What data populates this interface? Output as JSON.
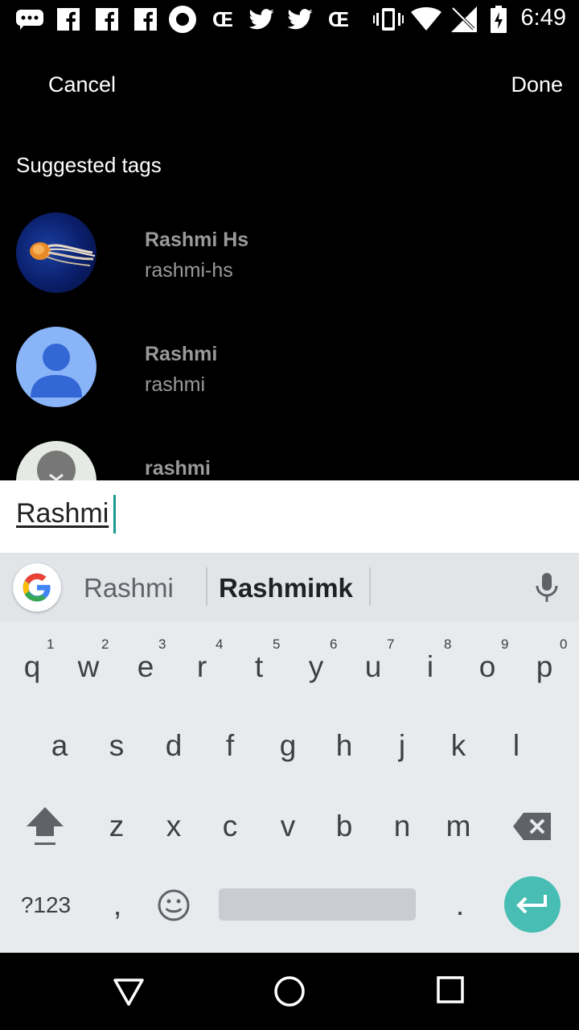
{
  "status_bar": {
    "time": "6:49",
    "icons": [
      "chat-icon",
      "facebook-icon",
      "facebook-icon",
      "facebook-icon",
      "record-icon",
      "ce-icon",
      "twitter-icon",
      "twitter-icon",
      "ce-icon",
      "vibrate-icon",
      "wifi-icon",
      "no-signal-icon",
      "battery-icon"
    ]
  },
  "header": {
    "cancel": "Cancel",
    "done": "Done"
  },
  "suggested": {
    "title": "Suggested tags",
    "items": [
      {
        "name": "Rashmi Hs",
        "handle": "rashmi-hs",
        "avatar": "jellyfish-photo"
      },
      {
        "name": "Rashmi",
        "handle": "rashmi",
        "avatar": "default-blue-avatar"
      },
      {
        "name": "rashmi",
        "handle": "",
        "avatar": "default-gray-avatar"
      }
    ]
  },
  "input": {
    "value": "Rashmi"
  },
  "keyboard": {
    "suggestions": [
      "Rashmi",
      "Rashmimk"
    ],
    "row1": [
      "q",
      "w",
      "e",
      "r",
      "t",
      "y",
      "u",
      "i",
      "o",
      "p"
    ],
    "row1_nums": [
      "1",
      "2",
      "3",
      "4",
      "5",
      "6",
      "7",
      "8",
      "9",
      "0"
    ],
    "row2": [
      "a",
      "s",
      "d",
      "f",
      "g",
      "h",
      "j",
      "k",
      "l"
    ],
    "row3": [
      "z",
      "x",
      "c",
      "v",
      "b",
      "n",
      "m"
    ],
    "symbols_label": "?123",
    "comma": ",",
    "period": ".",
    "accent": "#48bdb3"
  }
}
